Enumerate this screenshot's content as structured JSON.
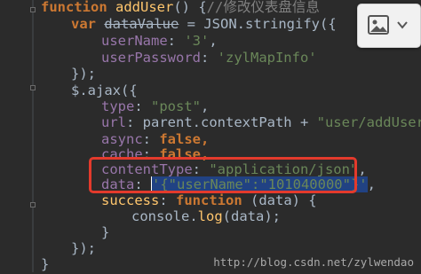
{
  "code": {
    "l1": {
      "kw": "function",
      "name": "addUser",
      "rest": "() {",
      "comment": "//修改仪表盘信息"
    },
    "l2": {
      "kw": "var",
      "var": "dataValue",
      "rest": " = JSON.stringify({"
    },
    "l3": {
      "prop": "userName",
      "colon": ": ",
      "val": "'3'",
      "tail": ","
    },
    "l4": {
      "prop": "userPassword",
      "colon": ": ",
      "val": "'zylMapInfo'"
    },
    "l5": {
      "text": "});"
    },
    "l6": {
      "text": "$.ajax({"
    },
    "l7": {
      "prop": "type",
      "colon": ": ",
      "val": "\"post\"",
      "tail": ","
    },
    "l8": {
      "prop": "url",
      "colon": ": ",
      "mid": "parent.contextPath + ",
      "val": "\"user/addUser\"",
      "tail": ","
    },
    "l9": {
      "prop": "async",
      "colon": ": ",
      "val": "false",
      "tail": ","
    },
    "l10": {
      "prop": "cache",
      "colon": ": ",
      "val": "false",
      "tail": ","
    },
    "l11": {
      "prop": "contentType",
      "colon": ": ",
      "val": "\"application/json\"",
      "tail": ","
    },
    "l12": {
      "prop": "data",
      "colon": ": ",
      "val": "'{\"userName\":\"101040000\"}'",
      "tail": ","
    },
    "l13": {
      "prop": "success",
      "colon": ": ",
      "kw": "function",
      "rest": " (data) {"
    },
    "l14": {
      "obj": "console",
      "dot": ".",
      "fn": "log",
      "rest": "(data);"
    },
    "l15": {
      "text": "}"
    },
    "l16": {
      "text": "});"
    },
    "l17": {
      "text": "}"
    }
  },
  "toolbar": {
    "image_button_icon": "image-icon",
    "chevron_icon": "chevron-down-icon"
  },
  "watermark": "http://blog.csdn.net/zylwendao",
  "colors": {
    "background": "#2b2b2b",
    "keyword": "#cc7832",
    "string": "#6a8759",
    "property": "#9876aa",
    "function": "#ffc66d",
    "highlight_box": "#e33a2c",
    "selection": "#214283"
  }
}
